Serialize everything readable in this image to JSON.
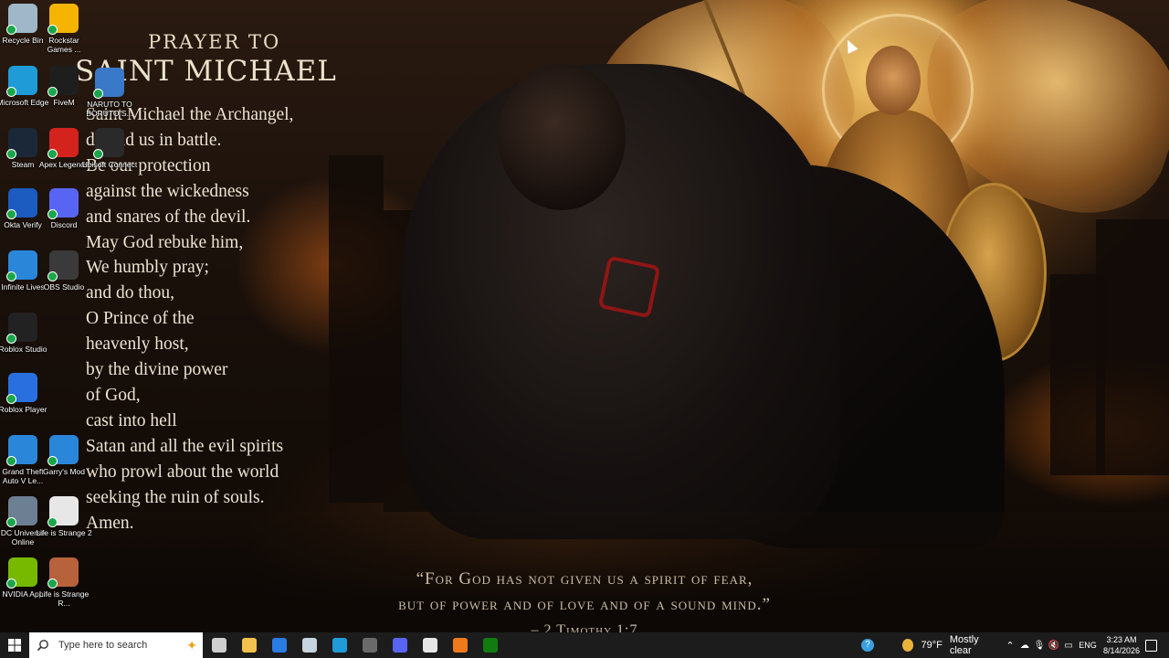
{
  "wallpaper": {
    "title_line1": "Prayer to",
    "title_line2": "Saint Michael",
    "prayer_lines": [
      "Saint Michael the Archangel,",
      "defend us in battle.",
      "Be our protection",
      "against the wickedness",
      "and snares of the devil.",
      "May God rebuke him,",
      "We humbly pray;",
      "and do thou,",
      "O Prince of the",
      "heavenly host,",
      "by the divine power",
      "of God,",
      "cast into hell",
      "Satan and all the evil spirits",
      "who prowl about the world",
      "seeking the ruin of souls.",
      "Amen."
    ],
    "verse_line1": "“For God has not given us a spirit of fear,",
    "verse_line2": "but of power and of love and of a sound mind.”",
    "verse_ref": "– 2 Timothy 1:7"
  },
  "desktop_icons": [
    {
      "label": "Recycle Bin",
      "icon": "recycle-bin-icon",
      "color": "#9fb7c9"
    },
    {
      "label": "Rockstar Games ...",
      "icon": "rockstar-icon",
      "color": "#f5b400"
    },
    {
      "label": "Microsoft Edge",
      "icon": "edge-icon",
      "color": "#1f9bd8"
    },
    {
      "label": "FiveM",
      "icon": "fivem-icon",
      "color": "#1e1e1e"
    },
    {
      "label": "NARUTO TO BORUTO S...",
      "icon": "naruto-icon",
      "color": "#3a78c8"
    },
    {
      "label": "Steam",
      "icon": "steam-icon",
      "color": "#1b2838"
    },
    {
      "label": "Apex Legends",
      "icon": "apex-icon",
      "color": "#d4231d"
    },
    {
      "label": "Ubisoft Connect",
      "icon": "ubisoft-icon",
      "color": "#2a2a2a"
    },
    {
      "label": "Okta Verify",
      "icon": "okta-icon",
      "color": "#1c5bbf"
    },
    {
      "label": "Discord",
      "icon": "discord-icon",
      "color": "#5865f2"
    },
    {
      "label": "Infinite Lives",
      "icon": "ie-icon",
      "color": "#2a86d9"
    },
    {
      "label": "OBS Studio",
      "icon": "obs-icon",
      "color": "#3a3a3a"
    },
    {
      "label": "Roblox Studio",
      "icon": "roblox-studio-icon",
      "color": "#222222"
    },
    {
      "label": "Roblox Player",
      "icon": "roblox-player-icon",
      "color": "#2a6fe0"
    },
    {
      "label": "Grand Theft Auto V Le...",
      "icon": "gta-icon",
      "color": "#2a86d9"
    },
    {
      "label": "Garry's Mod",
      "icon": "garrys-mod-icon",
      "color": "#2a86d9"
    },
    {
      "label": "DC Universe Online",
      "icon": "dcuo-icon",
      "color": "#6d7f93"
    },
    {
      "label": "Life is Strange 2",
      "icon": "lis2-icon",
      "color": "#e7e7e7"
    },
    {
      "label": "NVIDIA App",
      "icon": "nvidia-icon",
      "color": "#76b900"
    },
    {
      "label": "Life is Strange R...",
      "icon": "lis-remastered-icon",
      "color": "#b7623a"
    }
  ],
  "taskbar": {
    "search_placeholder": "Type here to search",
    "apps": [
      "task-view-icon",
      "file-explorer-icon",
      "microsoft-store-icon",
      "steam-icon",
      "edge-icon",
      "obs-icon",
      "discord-icon",
      "capcut-icon",
      "fivem-icon",
      "xbox-icon"
    ],
    "weather_temp": "79°F",
    "weather_text": "Mostly clear",
    "lang": "ENG",
    "time": "3:23 AM",
    "date": "8/14/2026"
  }
}
